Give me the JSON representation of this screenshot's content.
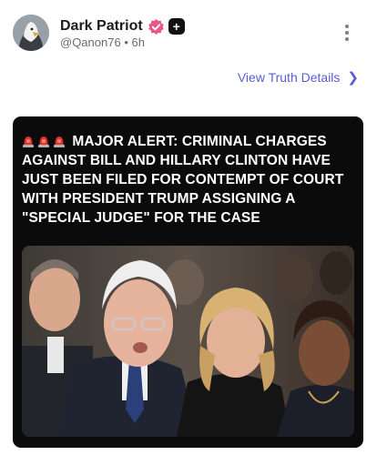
{
  "post": {
    "author": {
      "display_name": "Dark Patriot",
      "handle": "@Qanon76",
      "separator": "•",
      "time": "6h",
      "avatar_icon": "eagle-avatar-icon",
      "verified_icon": "verified-badge-icon",
      "plus_badge": "+"
    },
    "view_details_label": "View Truth Details",
    "view_details_chevron": "❯",
    "more_icon": "vertical-dots-icon",
    "colors": {
      "link": "#5b5bd6",
      "card_bg": "#0b0b0b",
      "verified": "#e8577f"
    }
  },
  "card": {
    "headline": "MAJOR ALERT: CRIMINAL CHARGES AGAINST BILL AND HILLARY CLINTON HAVE JUST BEEN FILED FOR CONTEMPT OF COURT WITH PRESIDENT TRUMP ASSIGNING A \"SPECIAL JUDGE\" FOR THE CASE",
    "lead_icons": [
      "siren-icon",
      "siren-icon",
      "siren-icon"
    ],
    "photo_description": "photo"
  }
}
